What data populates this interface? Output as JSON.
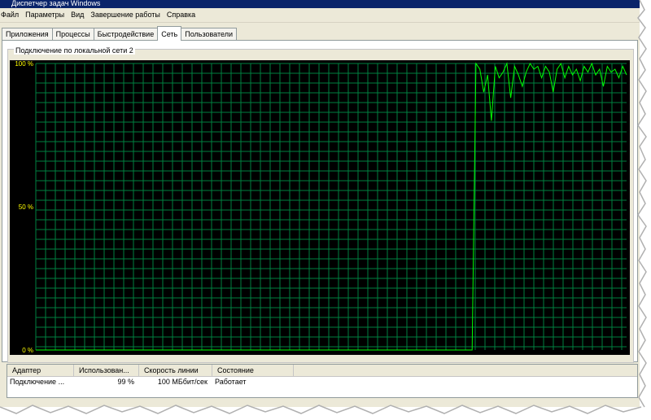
{
  "window": {
    "title": "Диспетчер задач Windows"
  },
  "menu": [
    {
      "id": "file",
      "label": "Файл"
    },
    {
      "id": "params",
      "label": "Параметры"
    },
    {
      "id": "view",
      "label": "Вид"
    },
    {
      "id": "shutdown",
      "label": "Завершение работы"
    },
    {
      "id": "help",
      "label": "Справка"
    }
  ],
  "tabs": [
    {
      "id": "apps",
      "label": "Приложения"
    },
    {
      "id": "processes",
      "label": "Процессы"
    },
    {
      "id": "performance",
      "label": "Быстродействие"
    },
    {
      "id": "network",
      "label": "Сеть",
      "active": true
    },
    {
      "id": "users",
      "label": "Пользователи"
    }
  ],
  "network": {
    "connection_title": "Подключение по локальной сети 2",
    "y_labels": [
      "100 %",
      "50 %",
      "0 %"
    ]
  },
  "colors": {
    "grid": "#008040",
    "trace": "#00ff00",
    "axis_text": "#ffff00",
    "background": "#000000"
  },
  "chart_data": {
    "type": "line",
    "title": "Подключение по локальной сети 2",
    "ylabel": "",
    "ylim": [
      0,
      100
    ],
    "ytick_labels": [
      "0 %",
      "50 %",
      "100 %"
    ],
    "grid": true,
    "series": [
      {
        "values": [
          0,
          0,
          0,
          0,
          0,
          0,
          0,
          0,
          0,
          0,
          0,
          0,
          0,
          0,
          0,
          0,
          0,
          0,
          0,
          0,
          0,
          0,
          0,
          0,
          0,
          0,
          0,
          0,
          0,
          0,
          0,
          0,
          0,
          0,
          0,
          0,
          0,
          0,
          0,
          0,
          0,
          0,
          0,
          0,
          0,
          0,
          0,
          0,
          0,
          0,
          0,
          0,
          0,
          0,
          0,
          0,
          0,
          0,
          0,
          0,
          0,
          0,
          0,
          0,
          0,
          0,
          0,
          0,
          0,
          0,
          0,
          0,
          0,
          0,
          0,
          0,
          0,
          0,
          0,
          0,
          0,
          0,
          0,
          0,
          0,
          0,
          0,
          0,
          0,
          0,
          0,
          0,
          0,
          0,
          0,
          0,
          0,
          0,
          0,
          0,
          0,
          0,
          0,
          0,
          0,
          0,
          0,
          0,
          0,
          0,
          0,
          0,
          0,
          0,
          100,
          98,
          90,
          96,
          80,
          99,
          95,
          97,
          100,
          88,
          99,
          96,
          92,
          97,
          100,
          98,
          99,
          95,
          99,
          97,
          90,
          98,
          100,
          95,
          99,
          96,
          98,
          94,
          99,
          97,
          100,
          96,
          98,
          92,
          99,
          97,
          98,
          95,
          99,
          96
        ]
      }
    ]
  },
  "adapters": {
    "columns": [
      "Адаптер",
      "Использован...",
      "Скорость линии",
      "Состояние"
    ],
    "rows": [
      {
        "name": "Подключение ...",
        "usage": "99 %",
        "speed": "100 МБбит/сек",
        "status": "Работает"
      }
    ]
  }
}
